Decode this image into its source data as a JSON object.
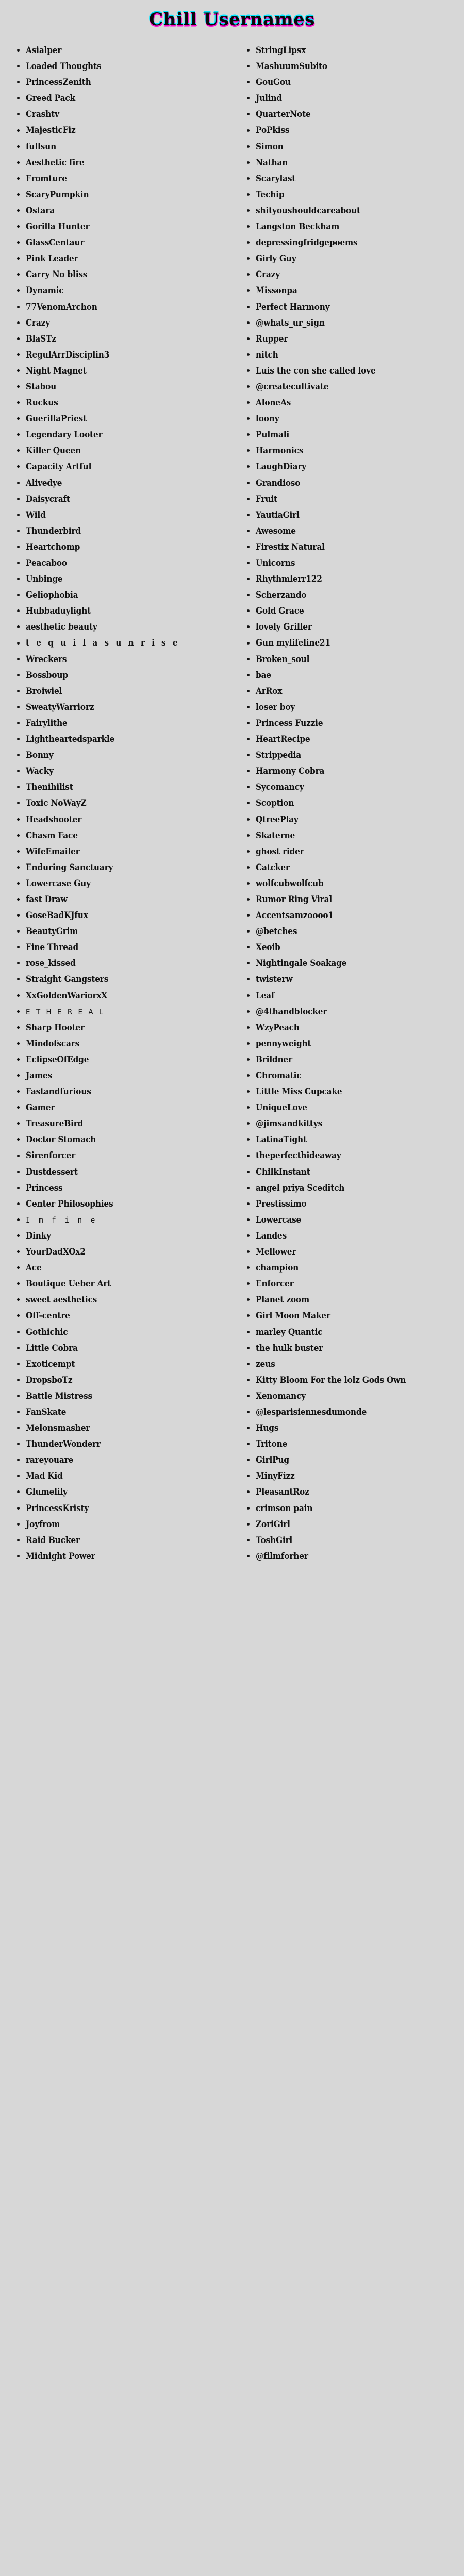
{
  "page": {
    "background_color": "#d7d7d7",
    "text_color": "#111111"
  },
  "header": {
    "title": "Chill Usernames",
    "glitch_cyan": "#00e5ff",
    "glitch_magenta": "#ff00d0"
  },
  "columns": [
    {
      "id": "left-column",
      "items": [
        {
          "text": "Asialper"
        },
        {
          "text": "Loaded Thoughts"
        },
        {
          "text": "PrincessZenith"
        },
        {
          "text": "Greed Pack"
        },
        {
          "text": "Crashtv"
        },
        {
          "text": "MajesticFiz"
        },
        {
          "text": "fullsun"
        },
        {
          "text": "Aesthetic fire"
        },
        {
          "text": "Fromture"
        },
        {
          "text": "ScaryPumpkin"
        },
        {
          "text": "Ostara"
        },
        {
          "text": "Gorilla Hunter"
        },
        {
          "text": "GlassCentaur"
        },
        {
          "text": "Pink Leader"
        },
        {
          "text": "Carry No bliss"
        },
        {
          "text": "Dynamic"
        },
        {
          "text": "77VenomArchon"
        },
        {
          "text": "Crazy"
        },
        {
          "text": "BlaSTz"
        },
        {
          "text": "RegulArrDisciplin3"
        },
        {
          "text": "Night Magnet"
        },
        {
          "text": "Stabou"
        },
        {
          "text": "Ruckus"
        },
        {
          "text": "GuerillaPriest"
        },
        {
          "text": "Legendary Looter"
        },
        {
          "text": "Killer Queen"
        },
        {
          "text": "Capacity Artful"
        },
        {
          "text": "Alivedye"
        },
        {
          "text": "Daisycraft"
        },
        {
          "text": "Wild"
        },
        {
          "text": "Thunderbird"
        },
        {
          "text": "Heartchomp"
        },
        {
          "text": "Peacaboo"
        },
        {
          "text": "Unbinge"
        },
        {
          "text": "Geliophobia"
        },
        {
          "text": "Hubbaduylight"
        },
        {
          "text": "aesthetic beauty"
        },
        {
          "text": "t e q u i l a s u n r i s e",
          "style": "spaced"
        },
        {
          "text": "Wreckers"
        },
        {
          "text": "Bossboup"
        },
        {
          "text": "Broiwiel"
        },
        {
          "text": "SweatyWarriorz"
        },
        {
          "text": "Fairylithe"
        },
        {
          "text": "Lightheartedsparkle"
        },
        {
          "text": "Bonny"
        },
        {
          "text": "Wacky"
        },
        {
          "text": "Thenihilist"
        },
        {
          "text": "Toxic NoWayZ"
        },
        {
          "text": "Headshooter"
        },
        {
          "text": "Chasm Face"
        },
        {
          "text": "WifeEmailer"
        },
        {
          "text": "Enduring Sanctuary"
        },
        {
          "text": "Lowercase Guy"
        },
        {
          "text": "fast Draw"
        },
        {
          "text": "GoseBadKJfux"
        },
        {
          "text": "BeautyGrim"
        },
        {
          "text": "Fine Thread"
        },
        {
          "text": "rose_kissed"
        },
        {
          "text": "Straight Gangsters"
        },
        {
          "text": "XxGoldenWariorxX"
        },
        {
          "text": "E T H E R E A L",
          "style": "sans"
        },
        {
          "text": "Sharp Hooter"
        },
        {
          "text": "Mindofscars"
        },
        {
          "text": "EclipseOfEdge"
        },
        {
          "text": "James"
        },
        {
          "text": "Fastandfurious"
        },
        {
          "text": "Gamer"
        },
        {
          "text": "TreasureBird"
        },
        {
          "text": "Doctor Stomach"
        },
        {
          "text": "Sirenforcer"
        },
        {
          "text": "Dustdessert"
        },
        {
          "text": "Princess"
        },
        {
          "text": "Center Philosophies"
        },
        {
          "text": "I m f i n e",
          "style": "mono"
        },
        {
          "text": "Dinky"
        },
        {
          "text": "YourDadXOx2"
        },
        {
          "text": "Ace"
        },
        {
          "text": "Boutique Ueber Art"
        },
        {
          "text": "sweet aesthetics"
        },
        {
          "text": "Off-centre"
        },
        {
          "text": "Gothichic"
        },
        {
          "text": "Little Cobra"
        },
        {
          "text": "Exoticempt"
        },
        {
          "text": "DropsboTz"
        },
        {
          "text": "Battle Mistress"
        },
        {
          "text": "FanSkate"
        },
        {
          "text": "Melonsmasher"
        },
        {
          "text": "ThunderWonderr"
        },
        {
          "text": "rareyouare"
        },
        {
          "text": "Mad Kid"
        },
        {
          "text": "Glumelily"
        },
        {
          "text": "PrincessKristy"
        },
        {
          "text": "Joyfrom"
        },
        {
          "text": "Raid Bucker"
        },
        {
          "text": "Midnight Power"
        }
      ]
    },
    {
      "id": "right-column",
      "items": [
        {
          "text": "StringLipsx"
        },
        {
          "text": "MashuumSubito"
        },
        {
          "text": "GouGou"
        },
        {
          "text": "Julind"
        },
        {
          "text": "QuarterNote"
        },
        {
          "text": "PoPkiss"
        },
        {
          "text": "Simon"
        },
        {
          "text": "Nathan"
        },
        {
          "text": "Scarylast"
        },
        {
          "text": "Techip"
        },
        {
          "text": "shityoushouldcareabout"
        },
        {
          "text": "Langston Beckham"
        },
        {
          "text": "depressingfridgepoems"
        },
        {
          "text": "Girly Guy"
        },
        {
          "text": "Crazy"
        },
        {
          "text": "Missonpa"
        },
        {
          "text": "Perfect Harmony"
        },
        {
          "text": "@whats_ur_sign"
        },
        {
          "text": "Rupper"
        },
        {
          "text": "nitch"
        },
        {
          "text": "Luis the con she called love"
        },
        {
          "text": "@createcultivate"
        },
        {
          "text": "AloneAs"
        },
        {
          "text": "loony"
        },
        {
          "text": "Pulmali"
        },
        {
          "text": "Harmonics"
        },
        {
          "text": "LaughDiary"
        },
        {
          "text": "Grandioso"
        },
        {
          "text": "Fruit"
        },
        {
          "text": "YautiaGirl"
        },
        {
          "text": "Awesome"
        },
        {
          "text": "Firestix Natural"
        },
        {
          "text": "Unicorns"
        },
        {
          "text": "Rhythmlerr122"
        },
        {
          "text": "Scherzando"
        },
        {
          "text": "Gold Grace"
        },
        {
          "text": "lovely Griller"
        },
        {
          "text": "Gun mylifeline21"
        },
        {
          "text": "Broken_soul"
        },
        {
          "text": "bae"
        },
        {
          "text": "ArRox"
        },
        {
          "text": "loser boy"
        },
        {
          "text": "Princess Fuzzie"
        },
        {
          "text": "HeartRecipe"
        },
        {
          "text": "Strippedia"
        },
        {
          "text": "Harmony Cobra"
        },
        {
          "text": "Sycomancy"
        },
        {
          "text": "Scoption"
        },
        {
          "text": "QtreePlay"
        },
        {
          "text": "Skaterne"
        },
        {
          "text": "ghost rider"
        },
        {
          "text": "Catcker"
        },
        {
          "text": "wolfcubwolfcub"
        },
        {
          "text": "Rumor Ring Viral"
        },
        {
          "text": "Accentsamzoooo1"
        },
        {
          "text": "@betches"
        },
        {
          "text": "Xeoib"
        },
        {
          "text": "Nightingale Soakage"
        },
        {
          "text": "twisterw"
        },
        {
          "text": "Leaf"
        },
        {
          "text": "@4thandblocker"
        },
        {
          "text": "WzyPeach"
        },
        {
          "text": "pennyweight"
        },
        {
          "text": "Brildner"
        },
        {
          "text": "Chromatic"
        },
        {
          "text": "Little Miss Cupcake"
        },
        {
          "text": "UniqueLove"
        },
        {
          "text": "@jimsandkittys"
        },
        {
          "text": "LatinaTight"
        },
        {
          "text": "theperfecthideaway"
        },
        {
          "text": "ChilkInstant"
        },
        {
          "text": "angel priya Sceditch"
        },
        {
          "text": "Prestissimo"
        },
        {
          "text": "Lowercase"
        },
        {
          "text": "Landes"
        },
        {
          "text": "Mellower"
        },
        {
          "text": "champion"
        },
        {
          "text": "Enforcer"
        },
        {
          "text": "Planet zoom"
        },
        {
          "text": "Girl Moon Maker"
        },
        {
          "text": "marley Quantic"
        },
        {
          "text": "the hulk buster"
        },
        {
          "text": "zeus"
        },
        {
          "text": "Kitty Bloom For the lolz Gods Own"
        },
        {
          "text": "Xenomancy"
        },
        {
          "text": "@lesparisiennesdumonde"
        },
        {
          "text": "Hugs"
        },
        {
          "text": "Tritone"
        },
        {
          "text": "GirlPug"
        },
        {
          "text": "MinyFizz"
        },
        {
          "text": "PleasantRoz"
        },
        {
          "text": "crimson pain"
        },
        {
          "text": "ZoriGirl"
        },
        {
          "text": "ToshGirl"
        },
        {
          "text": "@filmforher"
        }
      ]
    }
  ]
}
